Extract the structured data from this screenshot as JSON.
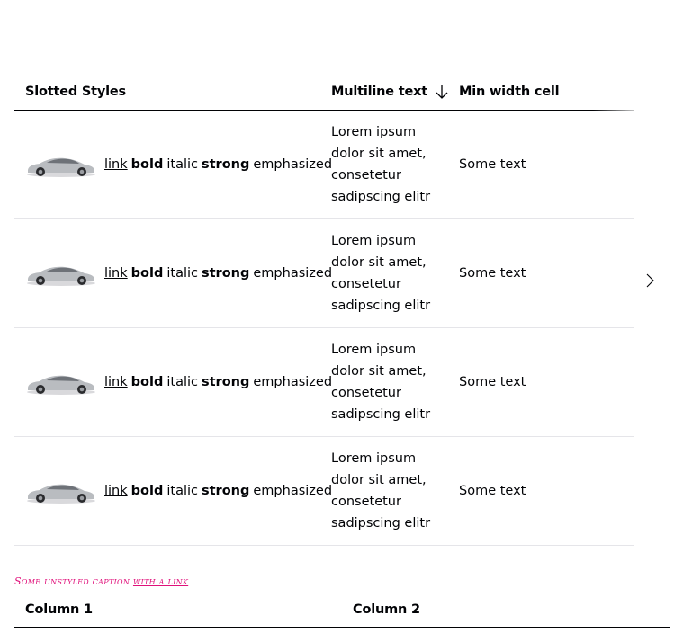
{
  "table": {
    "headers": {
      "slotted": "Slotted Styles",
      "multiline": "Multiline text",
      "minwidth": "Min width cell"
    },
    "rows": [
      {
        "link": "link",
        "bold": "bold",
        "italic": "italic",
        "strong": "strong",
        "em": "emphasized",
        "multiline": "Lorem ipsum dolor sit amet, consetetur sadipscing elitr",
        "text": "Some text"
      },
      {
        "link": "link",
        "bold": "bold",
        "italic": "italic",
        "strong": "strong",
        "em": "emphasized",
        "multiline": "Lorem ipsum dolor sit amet, consetetur sadipscing elitr",
        "text": "Some text"
      },
      {
        "link": "link",
        "bold": "bold",
        "italic": "italic",
        "strong": "strong",
        "em": "emphasized",
        "multiline": "Lorem ipsum dolor sit amet, consetetur sadipscing elitr",
        "text": "Some text"
      },
      {
        "link": "link",
        "bold": "bold",
        "italic": "italic",
        "strong": "strong",
        "em": "emphasized",
        "multiline": "Lorem ipsum dolor sit amet, consetetur sadipscing elitr",
        "text": "Some text"
      }
    ],
    "scroll_icon": "chevron-right-icon",
    "sort_icon": "arrow-down-icon"
  },
  "caption": {
    "text": "Some unstyled caption",
    "link": "with a link"
  },
  "table2": {
    "headers": {
      "col1": "Column 1",
      "col2": "Column 2"
    }
  },
  "colors": {
    "text": "#010205",
    "caption": "#e0107a",
    "row_divider": "#e5e5e9"
  }
}
